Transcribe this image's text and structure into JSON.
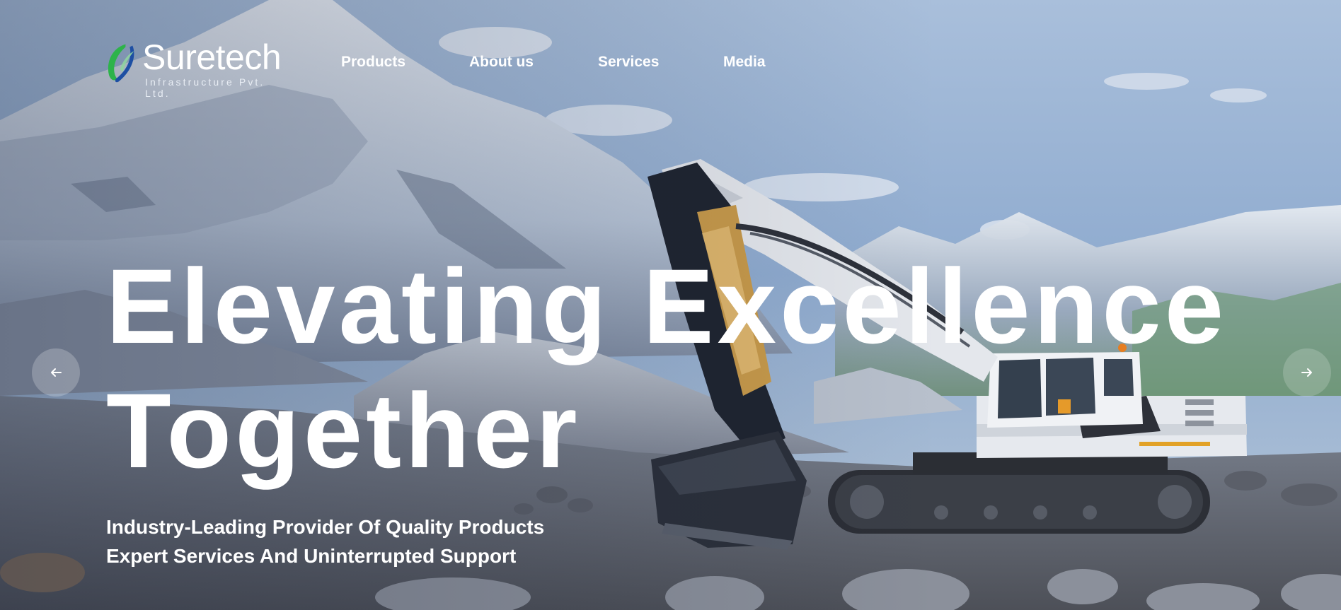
{
  "brand": {
    "name": "Suretech",
    "tagline": "Infrastructure Pvt. Ltd.",
    "colors": {
      "mark_green": "#2db34a",
      "mark_blue": "#1d4fa3"
    }
  },
  "nav": {
    "items": [
      {
        "label": "Products"
      },
      {
        "label": "About us"
      },
      {
        "label": "Services"
      },
      {
        "label": "Media"
      }
    ]
  },
  "hero": {
    "headline_line1": "Elevating Excellence",
    "headline_line2": "Together",
    "subtext": "Industry-Leading Provider Of Quality Products Expert Services And Uninterrupted Support",
    "background": "snowy-mountains-with-excavator",
    "colors": {
      "text": "#ffffff",
      "sky": "#8ea9cb"
    }
  },
  "carousel": {
    "prev_icon": "arrow-left-icon",
    "next_icon": "arrow-right-icon"
  }
}
